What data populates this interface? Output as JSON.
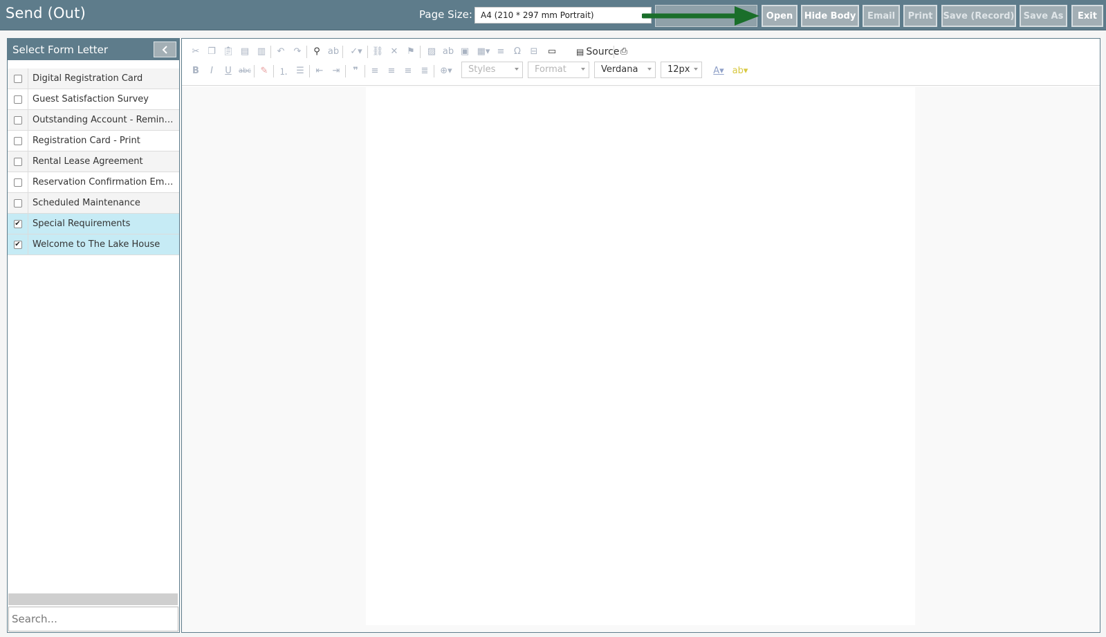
{
  "app": {
    "title": "Send (Out)"
  },
  "page_size": {
    "label": "Page Size:",
    "value": "A4 (210 * 297 mm Portrait)"
  },
  "top_buttons": {
    "open": "Open",
    "hide_body": "Hide Body",
    "email": "Email",
    "print": "Print",
    "save_record": "Save (Record)",
    "save_as": "Save As",
    "exit": "Exit"
  },
  "left_panel": {
    "title": "Select Form Letter",
    "items": [
      {
        "label": "Digital Registration Card",
        "checked": false
      },
      {
        "label": "Guest Satisfaction Survey",
        "checked": false
      },
      {
        "label": "Outstanding Account - Reminde...",
        "checked": false
      },
      {
        "label": "Registration Card - Print",
        "checked": false
      },
      {
        "label": "Rental Lease Agreement",
        "checked": false
      },
      {
        "label": "Reservation Confirmation Email",
        "checked": false
      },
      {
        "label": "Scheduled Maintenance",
        "checked": false
      },
      {
        "label": "Special Requirements",
        "checked": true
      },
      {
        "label": "Welcome to The Lake House",
        "checked": true
      }
    ],
    "search_placeholder": "Search..."
  },
  "editor": {
    "source_label": "Source",
    "styles_combo": "Styles",
    "format_combo": "Format",
    "font_combo": "Verdana",
    "size_combo": "12px"
  },
  "colors": {
    "header_bg": "#5e7c8b",
    "button_bg": "#a3afb5",
    "selected_row": "#c6ebf5",
    "arrow": "#1a6e2a"
  },
  "icons": [
    "cut-icon",
    "copy-icon",
    "paste-icon",
    "paste-text-icon",
    "paste-word-icon",
    "undo-icon",
    "redo-icon",
    "find-icon",
    "replace-icon",
    "spellcheck-icon",
    "link-icon",
    "unlink-icon",
    "anchor-icon",
    "image-icon",
    "flash-icon",
    "image2-icon",
    "table-icon",
    "horizontal-rule-icon",
    "special-char-icon",
    "page-break-icon",
    "iframe-icon",
    "source-icon",
    "print-icon",
    "bold-icon",
    "italic-icon",
    "underline-icon",
    "strikethrough-icon",
    "remove-format-icon",
    "numbered-list-icon",
    "bulleted-list-icon",
    "outdent-icon",
    "indent-icon",
    "blockquote-icon",
    "align-left-icon",
    "align-center-icon",
    "align-right-icon",
    "align-justify-icon",
    "language-icon",
    "text-color-icon",
    "background-color-icon",
    "collapse-chevron-icon",
    "green-arrow-icon"
  ]
}
